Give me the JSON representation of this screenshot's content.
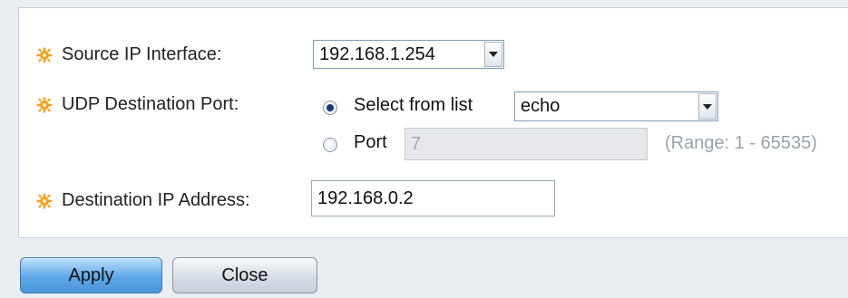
{
  "form": {
    "source_ip_interface": {
      "label": "Source IP Interface:",
      "value": "192.168.1.254"
    },
    "udp_destination_port": {
      "label": "UDP Destination Port:",
      "select_option_label": "Select from list",
      "select_value": "echo",
      "port_option_label": "Port",
      "port_value": "7",
      "range_hint": "(Range: 1 - 65535)",
      "selected_option": "select_from_list"
    },
    "destination_ip_address": {
      "label": "Destination IP Address:",
      "value": "192.168.0.2"
    }
  },
  "buttons": {
    "apply_label": "Apply",
    "close_label": "Close"
  },
  "icons": {
    "required": "gear-icon"
  },
  "colors": {
    "required_icon": "#f0a020",
    "apply_button": "#5fa8e8"
  }
}
